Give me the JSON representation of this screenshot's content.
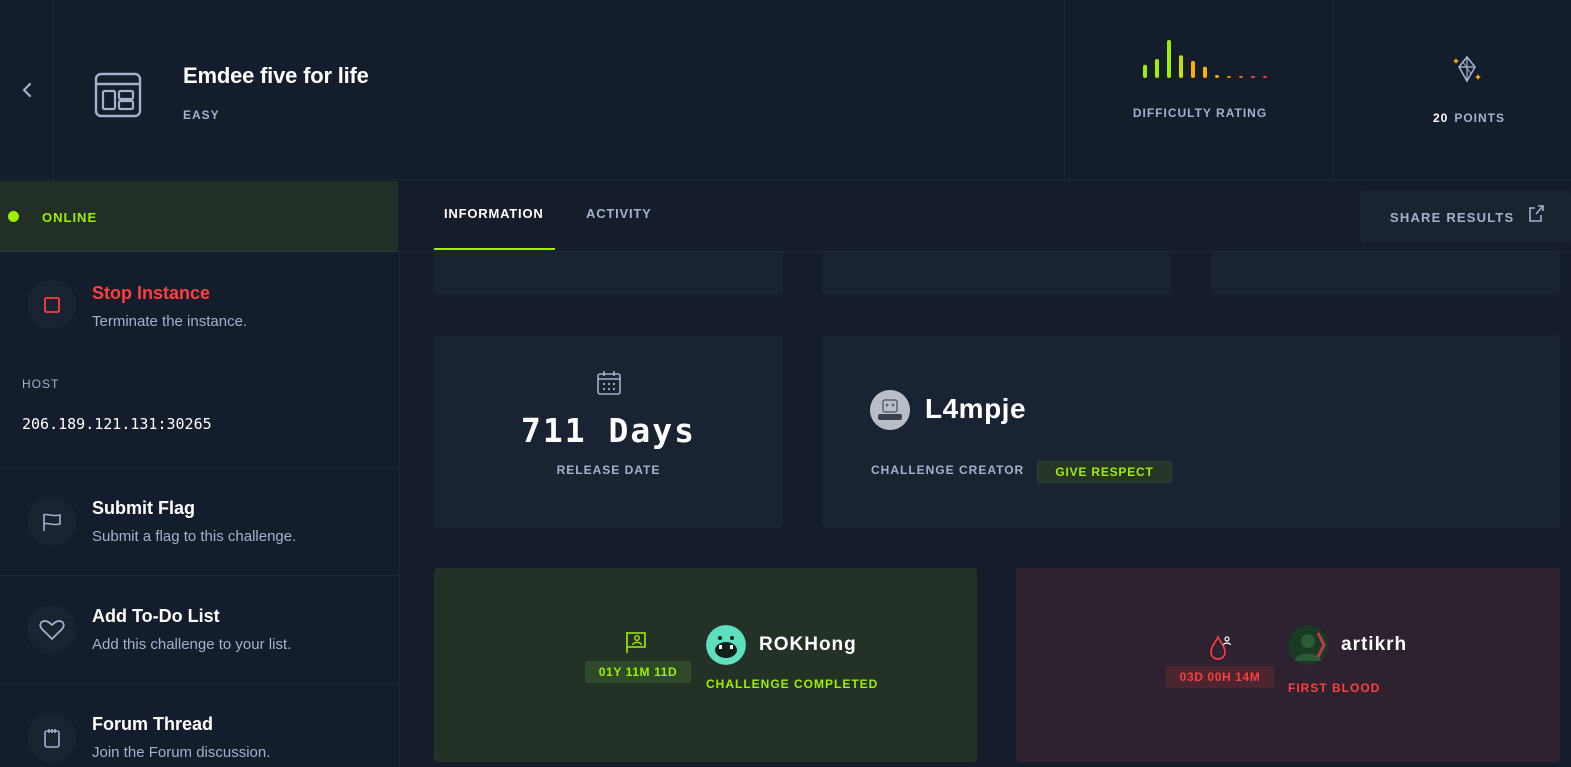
{
  "header": {
    "title": "Emdee five for life",
    "difficulty": "EASY",
    "difficulty_caption": "DIFFICULTY RATING",
    "points_value": "20",
    "points_label": "POINTS",
    "difficulty_bars": [
      {
        "level": 0.35,
        "color": "#9fef00"
      },
      {
        "level": 0.5,
        "color": "#9fef00"
      },
      {
        "level": 1.0,
        "color": "#9fef00"
      },
      {
        "level": 0.6,
        "color": "#c6e200"
      },
      {
        "level": 0.45,
        "color": "#ffaf00"
      },
      {
        "level": 0.3,
        "color": "#ffaf00"
      },
      {
        "level": 0.08,
        "color": "#ffaf00"
      },
      {
        "level": 0.04,
        "color": "#ff8a00"
      },
      {
        "level": 0.04,
        "color": "#ff6a00"
      },
      {
        "level": 0.04,
        "color": "#ff4a2a"
      },
      {
        "level": 0.04,
        "color": "#ff3e3e"
      }
    ]
  },
  "status": {
    "text": "ONLINE",
    "color": "#9fef00"
  },
  "tabs": [
    {
      "label": "INFORMATION",
      "active": true
    },
    {
      "label": "ACTIVITY",
      "active": false
    }
  ],
  "share": {
    "label": "SHARE RESULTS"
  },
  "sidebar": {
    "stop": {
      "title": "Stop Instance",
      "desc": "Terminate the instance."
    },
    "host_label": "HOST",
    "host_value": "206.189.121.131:30265",
    "actions": [
      {
        "title": "Submit Flag",
        "desc": "Submit a flag to this challenge."
      },
      {
        "title": "Add To-Do List",
        "desc": "Add this challenge to your list."
      },
      {
        "title": "Forum Thread",
        "desc": "Join the Forum discussion."
      }
    ]
  },
  "release": {
    "value": "711 Days",
    "label": "RELEASE DATE"
  },
  "creator": {
    "name": "L4mpje",
    "label": "CHALLENGE CREATOR",
    "respect": "GIVE RESPECT"
  },
  "completed": {
    "time": "01Y 11M 11D",
    "user": "ROKHong",
    "label": "CHALLENGE COMPLETED"
  },
  "first_blood": {
    "time": "03D 00H 14M",
    "user": "artikrh",
    "label": "FIRST BLOOD"
  },
  "colors": {
    "accent": "#9fef00",
    "danger": "#ff3e3e",
    "background": "#141d2b",
    "panel": "#1a2332",
    "muted": "#a4b1cd"
  }
}
